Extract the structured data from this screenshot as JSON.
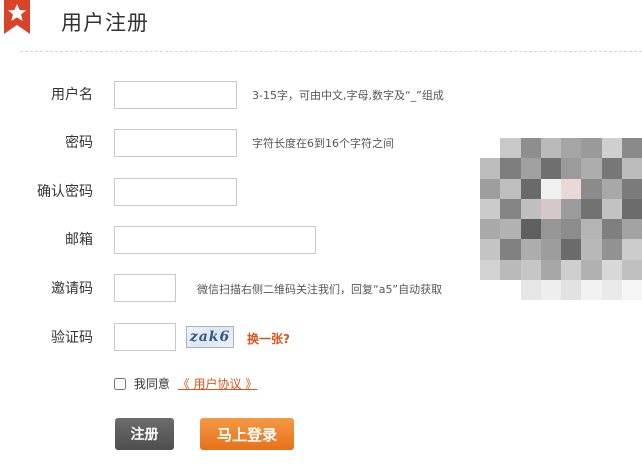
{
  "header": {
    "title": "用户注册"
  },
  "form": {
    "username": {
      "label": "用户名",
      "value": "",
      "hint": "3-15字，可由中文,字母,数字及“_”组成"
    },
    "password": {
      "label": "密码",
      "value": "",
      "hint": "字符长度在6到16个字符之间"
    },
    "confirm_password": {
      "label": "确认密码",
      "value": ""
    },
    "email": {
      "label": "邮箱",
      "value": ""
    },
    "invite_code": {
      "label": "邀请码",
      "value": "",
      "hint": "微信扫描右侧二维码关注我们，回复“a5”自动获取"
    },
    "captcha": {
      "label": "验证码",
      "value": "",
      "image_text": "zak6",
      "refresh_label": "换一张?"
    },
    "agree": {
      "checked": false,
      "label": "我同意",
      "link_text": "《 用户协议 》"
    },
    "buttons": {
      "register": "注册",
      "login": "马上登录"
    }
  },
  "colors": {
    "accent": "#e8701a",
    "ribbon": "#d8432a",
    "link": "#d9541e"
  },
  "icons": {
    "ribbon": "star-icon",
    "qr": "qr-code-image-blurred"
  }
}
